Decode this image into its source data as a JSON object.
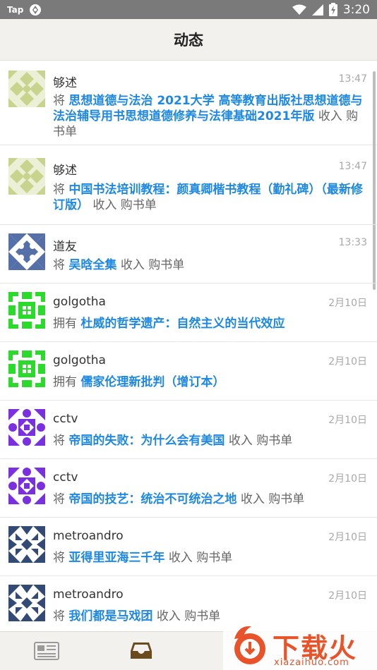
{
  "status_bar": {
    "carrier": "Tap",
    "time": "3:20",
    "icons": [
      "mirror-icon",
      "wifi-icon",
      "signal-icon",
      "battery-charging-icon"
    ]
  },
  "header": {
    "title": "动态"
  },
  "feed": [
    {
      "user": "够述",
      "time": "13:47",
      "verb": "将",
      "book": "思想道德与法治 2021大学 高等教育出版社思想道德与法治辅导用书思想道德修养与法律基础2021年版",
      "suffix": "收入 购书单",
      "avatar_color": "#c8d48d"
    },
    {
      "user": "够述",
      "time": "13:47",
      "verb": "将",
      "book": "中国书法培训教程：颜真卿楷书教程（勤礼碑）（最新修订版）",
      "suffix": "收入 购书单",
      "avatar_color": "#c8d48d"
    },
    {
      "user": "道友",
      "time": "13:33",
      "verb": "将",
      "book": "吴晗全集",
      "suffix": "收入 购书单",
      "avatar_color": "#5570a8"
    },
    {
      "user": "golgotha",
      "time": "2月10日",
      "verb": "拥有",
      "book": "杜威的哲学遗产：自然主义的当代效应",
      "suffix": "",
      "avatar_color": "#2bdb2b"
    },
    {
      "user": "golgotha",
      "time": "2月10日",
      "verb": "拥有",
      "book": "儒家伦理新批判（增订本）",
      "suffix": "",
      "avatar_color": "#2bdb2b"
    },
    {
      "user": "cctv",
      "time": "2月10日",
      "verb": "将",
      "book": "帝国的失败：为什么会有美国",
      "suffix": "收入 购书单",
      "avatar_color": "#7a2fe0"
    },
    {
      "user": "cctv",
      "time": "2月10日",
      "verb": "将",
      "book": "帝国的技艺：统治不可统治之地",
      "suffix": "收入 购书单",
      "avatar_color": "#7a2fe0"
    },
    {
      "user": "metroandro",
      "time": "2月10日",
      "verb": "将",
      "book": "亚得里亚海三千年",
      "suffix": "收入 购书单",
      "avatar_color": "#324a74"
    },
    {
      "user": "metroandro",
      "time": "2月10日",
      "verb": "将",
      "book": "我们都是马戏团",
      "suffix": "收入 购书单",
      "avatar_color": "#324a74"
    }
  ],
  "bottom_nav": {
    "items": [
      {
        "icon": "newspaper-icon",
        "active": false,
        "color": "#9a9a9a"
      },
      {
        "icon": "inbox-icon",
        "active": true,
        "color": "#6b4a1e"
      }
    ]
  },
  "watermark": {
    "brand": "下载火",
    "domain": "xiazaihuo.com",
    "color": "#e8532a"
  },
  "colors": {
    "link": "#1e88e5",
    "header_bg": "#f3f1ee",
    "status_bar": "#7a7a7a"
  }
}
